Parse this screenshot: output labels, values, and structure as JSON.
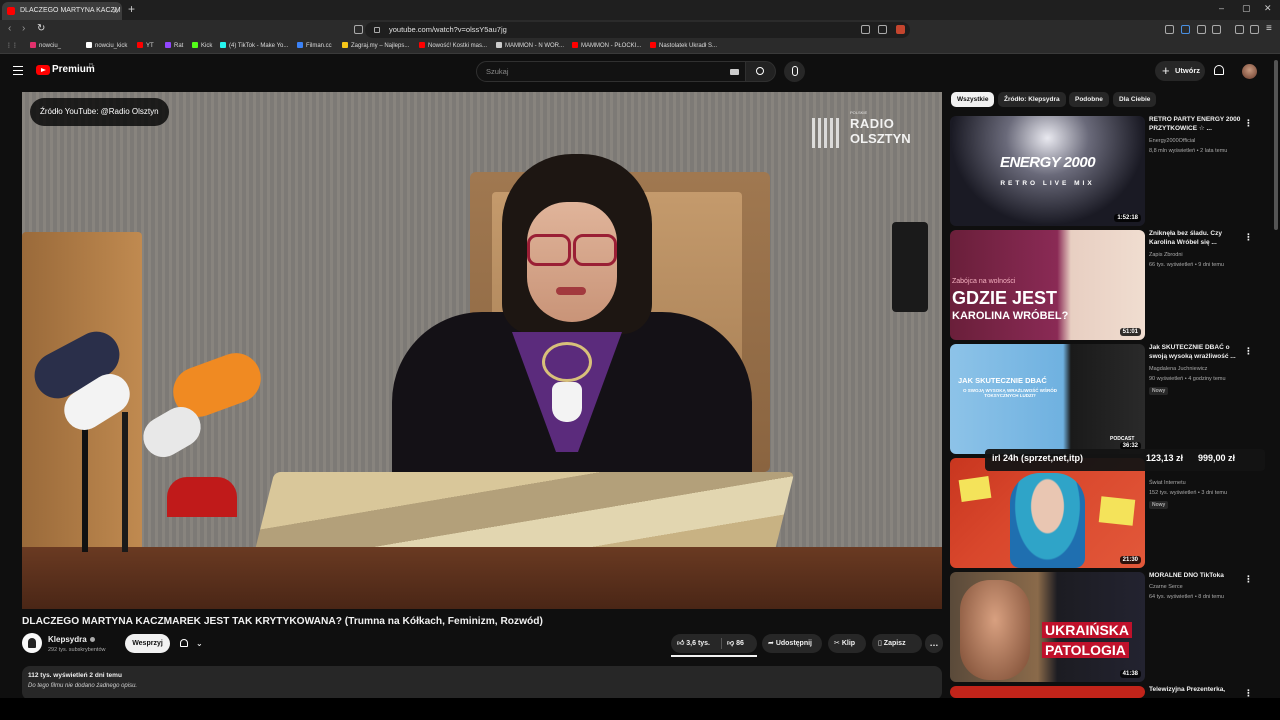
{
  "browser": {
    "tab_title": "DLACZEGO MARTYNA KACZM",
    "new_tab": "+",
    "url": "youtube.com/watch?v=olssY5au7jg",
    "window_controls": [
      "–",
      "▢",
      "✕"
    ],
    "bookmarks": [
      {
        "label": "nowciu_",
        "color": "#e1306c"
      },
      {
        "label": "nowciu_kick",
        "color": "#ffffff"
      },
      {
        "label": "YT",
        "color": "#ff0000"
      },
      {
        "label": "Rat",
        "color": "#9146ff"
      },
      {
        "label": "Kick",
        "color": "#53fc18"
      },
      {
        "label": "(4) TikTok - Make Yo...",
        "color": "#25f4ee"
      },
      {
        "label": "Filman.cc",
        "color": "#3b82f6"
      },
      {
        "label": "Zagraj.my – Najleps...",
        "color": "#f5c518"
      },
      {
        "label": "Nowość! Kostki mas...",
        "color": "#ff0000"
      },
      {
        "label": "MAMMON - N WOR...",
        "color": "#cccccc"
      },
      {
        "label": "MAMMON - PŁOCKI...",
        "color": "#ff0000"
      },
      {
        "label": "Nastolatek Ukradł S...",
        "color": "#ff0000"
      }
    ]
  },
  "header": {
    "brand": "Premium",
    "region": "PL",
    "search_placeholder": "Szukaj",
    "create_label": "Utwórz"
  },
  "player": {
    "source_watermark": "Źródło YouTube: @Radio Olsztyn",
    "logo_small": "POLSKIE",
    "logo_line1": "RADIO",
    "logo_line2": "OLSZTYN"
  },
  "video": {
    "title": "DLACZEGO MARTYNA KACZMAREK JEST TAK KRYTYKOWANA? (Trumna na Kółkach, Feminizm, Rozwód)",
    "channel": "Klepsydra",
    "subscribers": "292 tys. subskrybentów",
    "support_label": "Wesprzyj",
    "likes": "3,6 tys.",
    "dislikes": "86",
    "share_label": "Udostępnij",
    "clip_label": "Klip",
    "save_label": "Zapisz",
    "more_label": "…",
    "views_date": "112 tys. wyświetleń  2 dni temu",
    "description": "Do tego filmu nie dodano żadnego opisu."
  },
  "sidebar": {
    "chips": [
      "Wszystkie",
      "Źródło: Klepsydra",
      "Podobne",
      "Dla Ciebie"
    ],
    "recommendations": [
      {
        "title": "RETRO PARTY ENERGY 2000 PRZYTKOWICE ☆ ...",
        "channel": "Energy2000Official",
        "meta": "8,8 mln wyświetleń • 2 lata temu",
        "duration": "1:52:18",
        "thumb_text1": "ENERGY 2000",
        "thumb_text2": "RETRO LIVE MIX"
      },
      {
        "title": "Zniknęła bez śladu. Czy Karolina Wróbel się ...",
        "channel": "Zapis Zbrodni",
        "meta": "66 tys. wyświetleń • 9 dni temu",
        "duration": "51:01",
        "thumb_text0": "Zabójca na wolności",
        "thumb_text1": "GDZIE JEST",
        "thumb_text2": "KAROLINA WRÓBEL?"
      },
      {
        "title": "Jak SKUTECZNIE DBAĆ o swoją wysoką wrażliwość ...",
        "channel": "Magdalena Juchniewicz",
        "meta": "90 wyświetleń • 4 godziny temu",
        "badge": "Nowy",
        "duration": "36:32",
        "thumb_text1": "JAK SKUTECZNIE DBAĆ",
        "thumb_text2": "O SWOJĄ WYSOKĄ WRAŻLIWOŚĆ WŚRÓD TOKSYCZNYCH LUDZI?",
        "thumb_text3": "PODCAST"
      },
      {
        "title": "",
        "channel": "Świat Internetu",
        "meta": "152 tys. wyświetleń • 3 dni temu",
        "badge": "Nowy",
        "duration": "21:30"
      },
      {
        "title": "MORALNE DNO TikToka",
        "channel": "Czarne Serce",
        "meta": "64 tys. wyświetleń • 8 dni temu",
        "duration": "41:38",
        "thumb_text1": "UKRAIŃSKA",
        "thumb_text2": "PATOLOGIA"
      },
      {
        "title": "Telewizyjna Prezenterka,",
        "channel": "",
        "meta": ""
      }
    ]
  },
  "overlay": {
    "left_text": "irl 24h (sprzet,net,itp)",
    "amount1": "123,13 zł",
    "amount2": "999,00 zł"
  }
}
